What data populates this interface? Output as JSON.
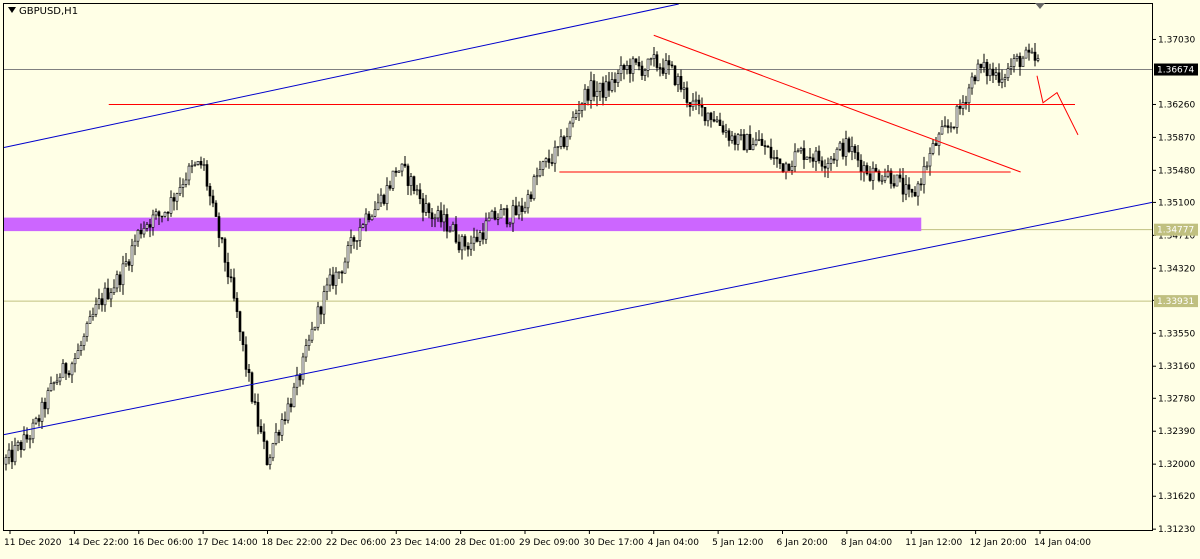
{
  "window": {
    "title": "GBPUSD,H1",
    "dropdown_icon": "triangle-down-icon",
    "scroll_marker_icon": "triangle-down-icon"
  },
  "colors": {
    "background": "#ffffe6",
    "frame": "#000000",
    "candles": "#000000",
    "price_line": "#808080",
    "level_line": "#c0c080",
    "red_trend": "#ff0000",
    "blue_channel": "#0000cc",
    "zone": "#cc66ff",
    "current_price_tag": "#000000",
    "level_tag": "#c0c080"
  },
  "chart_data": {
    "type": "candlestick",
    "symbol": "GBPUSD",
    "timeframe": "H1",
    "y_range": [
      1.3122,
      1.3745
    ],
    "y_ticks": [
      "1.37030",
      "1.36260",
      "1.35870",
      "1.35480",
      "1.35100",
      "1.34710",
      "1.34320",
      "1.33940",
      "1.33550",
      "1.33160",
      "1.32780",
      "1.32390",
      "1.32000",
      "1.31620",
      "1.31230"
    ],
    "x_labels": [
      "11 Dec 2020",
      "14 Dec 22:00",
      "16 Dec 06:00",
      "17 Dec 14:00",
      "18 Dec 22:00",
      "22 Dec 06:00",
      "23 Dec 14:00",
      "28 Dec 01:00",
      "29 Dec 09:00",
      "30 Dec 17:00",
      "4 Jan 04:00",
      "5 Jan 12:00",
      "6 Jan 20:00",
      "8 Jan 04:00",
      "11 Jan 12:00",
      "12 Jan 20:00",
      "14 Jan 04:00"
    ],
    "price_anchors": [
      [
        "11 Dec 2020",
        1.32
      ],
      [
        "14 Dec 22:00",
        1.333
      ],
      [
        "16 Dec 06:00",
        1.347
      ],
      [
        "17 Dec 14:00",
        1.356
      ],
      [
        "18 Dec 22:00",
        1.32
      ],
      [
        "22 Dec 06:00",
        1.342
      ],
      [
        "23 Dec 14:00",
        1.355
      ],
      [
        "28 Dec 01:00",
        1.346
      ],
      [
        "29 Dec 09:00",
        1.351
      ],
      [
        "30 Dec 17:00",
        1.364
      ],
      [
        "4 Jan 04:00",
        1.368
      ],
      [
        "5 Jan 12:00",
        1.36
      ],
      [
        "6 Jan 20:00",
        1.356
      ],
      [
        "8 Jan 04:00",
        1.357
      ],
      [
        "11 Jan 12:00",
        1.352
      ],
      [
        "12 Jan 20:00",
        1.366
      ],
      [
        "14 Jan 04:00",
        1.368
      ]
    ],
    "current_price": "1.36674",
    "levels": [
      {
        "price": 1.34777,
        "label": "1.34777"
      },
      {
        "price": 1.33931,
        "label": "1.33931"
      }
    ],
    "horizontal_resistance": [
      {
        "price": 1.3626,
        "from": "16 Dec 06:00",
        "to": "14 Jan 04:00"
      },
      {
        "price": 1.3546,
        "from": "30 Dec 17:00",
        "to": "12 Jan 20:00"
      }
    ],
    "zone": {
      "price_top": 1.3492,
      "price_bottom": 1.3476,
      "from": "11 Dec 2020",
      "to": "11 Jan 12:00"
    },
    "red_trendline": {
      "from": [
        "4 Jan 04:00",
        1.3708
      ],
      "to": [
        "12 Jan 20:00",
        1.3546
      ]
    },
    "blue_channel": {
      "upper": {
        "from": [
          "11 Dec 2020",
          1.3575
        ],
        "to": [
          "4 Jan 04:00",
          1.3745
        ]
      },
      "lower": {
        "from": [
          "11 Dec 2020",
          1.3235
        ],
        "to": [
          "14 Jan 04:00",
          1.351
        ]
      }
    },
    "projection": [
      [
        "14 Jan 04:00",
        1.366
      ],
      [
        "14 Jan 04:00",
        1.3628
      ],
      [
        "14 Jan 04:00",
        1.364
      ],
      [
        "14 Jan 04:00",
        1.359
      ]
    ]
  }
}
